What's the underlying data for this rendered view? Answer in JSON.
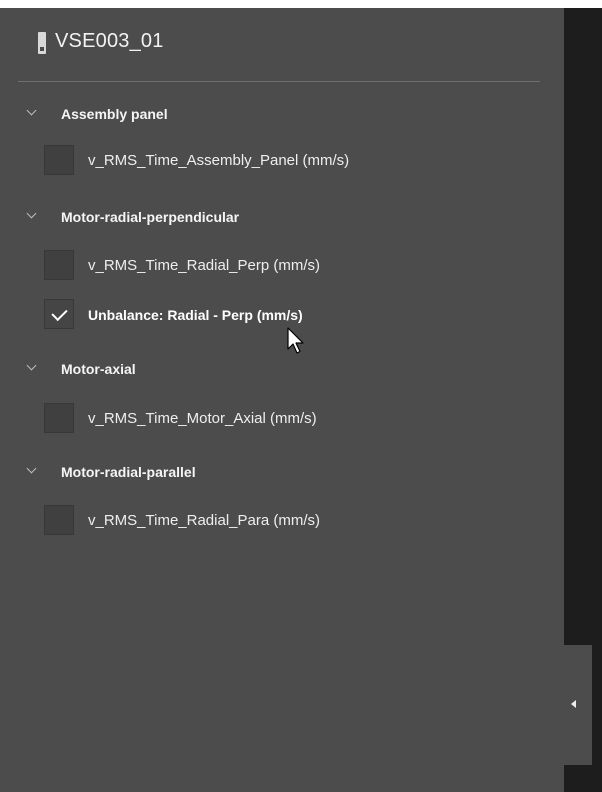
{
  "device": {
    "name": "VSE003_01",
    "icon": "device-icon"
  },
  "groups": [
    {
      "label": "Assembly panel",
      "items": [
        {
          "label": "v_RMS_Time_Assembly_Panel (mm/s)",
          "checked": false
        }
      ]
    },
    {
      "label": "Motor-radial-perpendicular",
      "items": [
        {
          "label": "v_RMS_Time_Radial_Perp (mm/s)",
          "checked": false
        },
        {
          "label": "Unbalance: Radial - Perp (mm/s)",
          "checked": true
        }
      ]
    },
    {
      "label": "Motor-axial",
      "items": [
        {
          "label": "v_RMS_Time_Motor_Axial (mm/s)",
          "checked": false
        }
      ]
    },
    {
      "label": "Motor-radial-parallel",
      "items": [
        {
          "label": "v_RMS_Time_Radial_Para (mm/s)",
          "checked": false
        }
      ]
    }
  ],
  "colors": {
    "panel": "#4c4c4c",
    "dark_strip": "#1d1d1d",
    "text": "#f2f2f2",
    "checkbox": "#404040"
  },
  "collapse_button_icon": "chevron-left-icon"
}
